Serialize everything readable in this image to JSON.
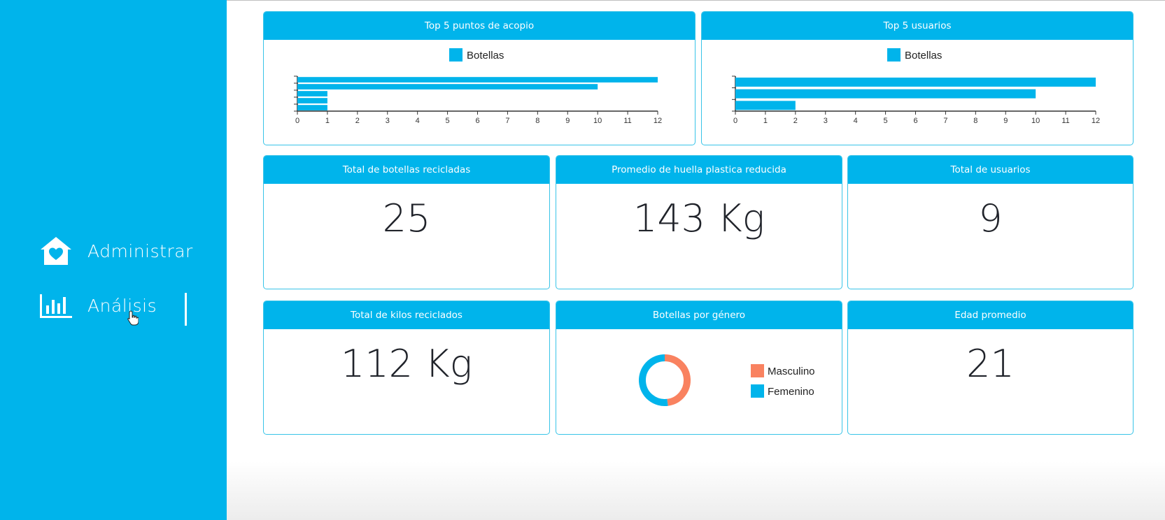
{
  "sidebar": {
    "items": [
      {
        "label": "Administrar",
        "icon": "house-heart-icon"
      },
      {
        "label": "Análisis",
        "icon": "bar-chart-icon",
        "active": true
      }
    ],
    "color": "#00b4eb"
  },
  "cards": {
    "top_puntos": {
      "title": "Top 5 puntos de acopio"
    },
    "top_usuarios": {
      "title": "Top 5 usuarios"
    },
    "total_botellas": {
      "title": "Total de botellas recicladas",
      "value": "25"
    },
    "promedio_huella": {
      "title": "Promedio de huella plastica reducida",
      "value": "143 Kg"
    },
    "total_usuarios": {
      "title": "Total de usuarios",
      "value": "9"
    },
    "total_kilos": {
      "title": "Total de kilos reciclados",
      "value": "112 Kg"
    },
    "botellas_genero": {
      "title": "Botellas por género"
    },
    "edad_promedio": {
      "title": "Edad promedio",
      "value": "21"
    }
  },
  "chart_data": [
    {
      "type": "bar",
      "orientation": "horizontal",
      "title": "Top 5 puntos de acopio",
      "series": [
        {
          "name": "Botellas",
          "values": [
            12,
            10,
            1,
            1,
            1
          ],
          "color": "#00b4eb"
        }
      ],
      "xlim": [
        0,
        12
      ],
      "xticks": [
        "0",
        "1",
        "2",
        "3",
        "4",
        "5",
        "6",
        "7",
        "8",
        "9",
        "10",
        "11",
        "12"
      ],
      "legend": "top"
    },
    {
      "type": "bar",
      "orientation": "horizontal",
      "title": "Top 5 usuarios",
      "series": [
        {
          "name": "Botellas",
          "values": [
            12,
            10,
            2
          ],
          "color": "#00b4eb"
        }
      ],
      "xlim": [
        0,
        12
      ],
      "xticks": [
        "0",
        "1",
        "2",
        "3",
        "4",
        "5",
        "6",
        "7",
        "8",
        "9",
        "10",
        "11",
        "12"
      ],
      "legend": "top"
    },
    {
      "type": "pie",
      "title": "Botellas por género",
      "donut": true,
      "categories": [
        "Masculino",
        "Femenino"
      ],
      "values": [
        48,
        52
      ],
      "colors": [
        "#f98260",
        "#00b4eb"
      ],
      "legend": "right"
    }
  ]
}
